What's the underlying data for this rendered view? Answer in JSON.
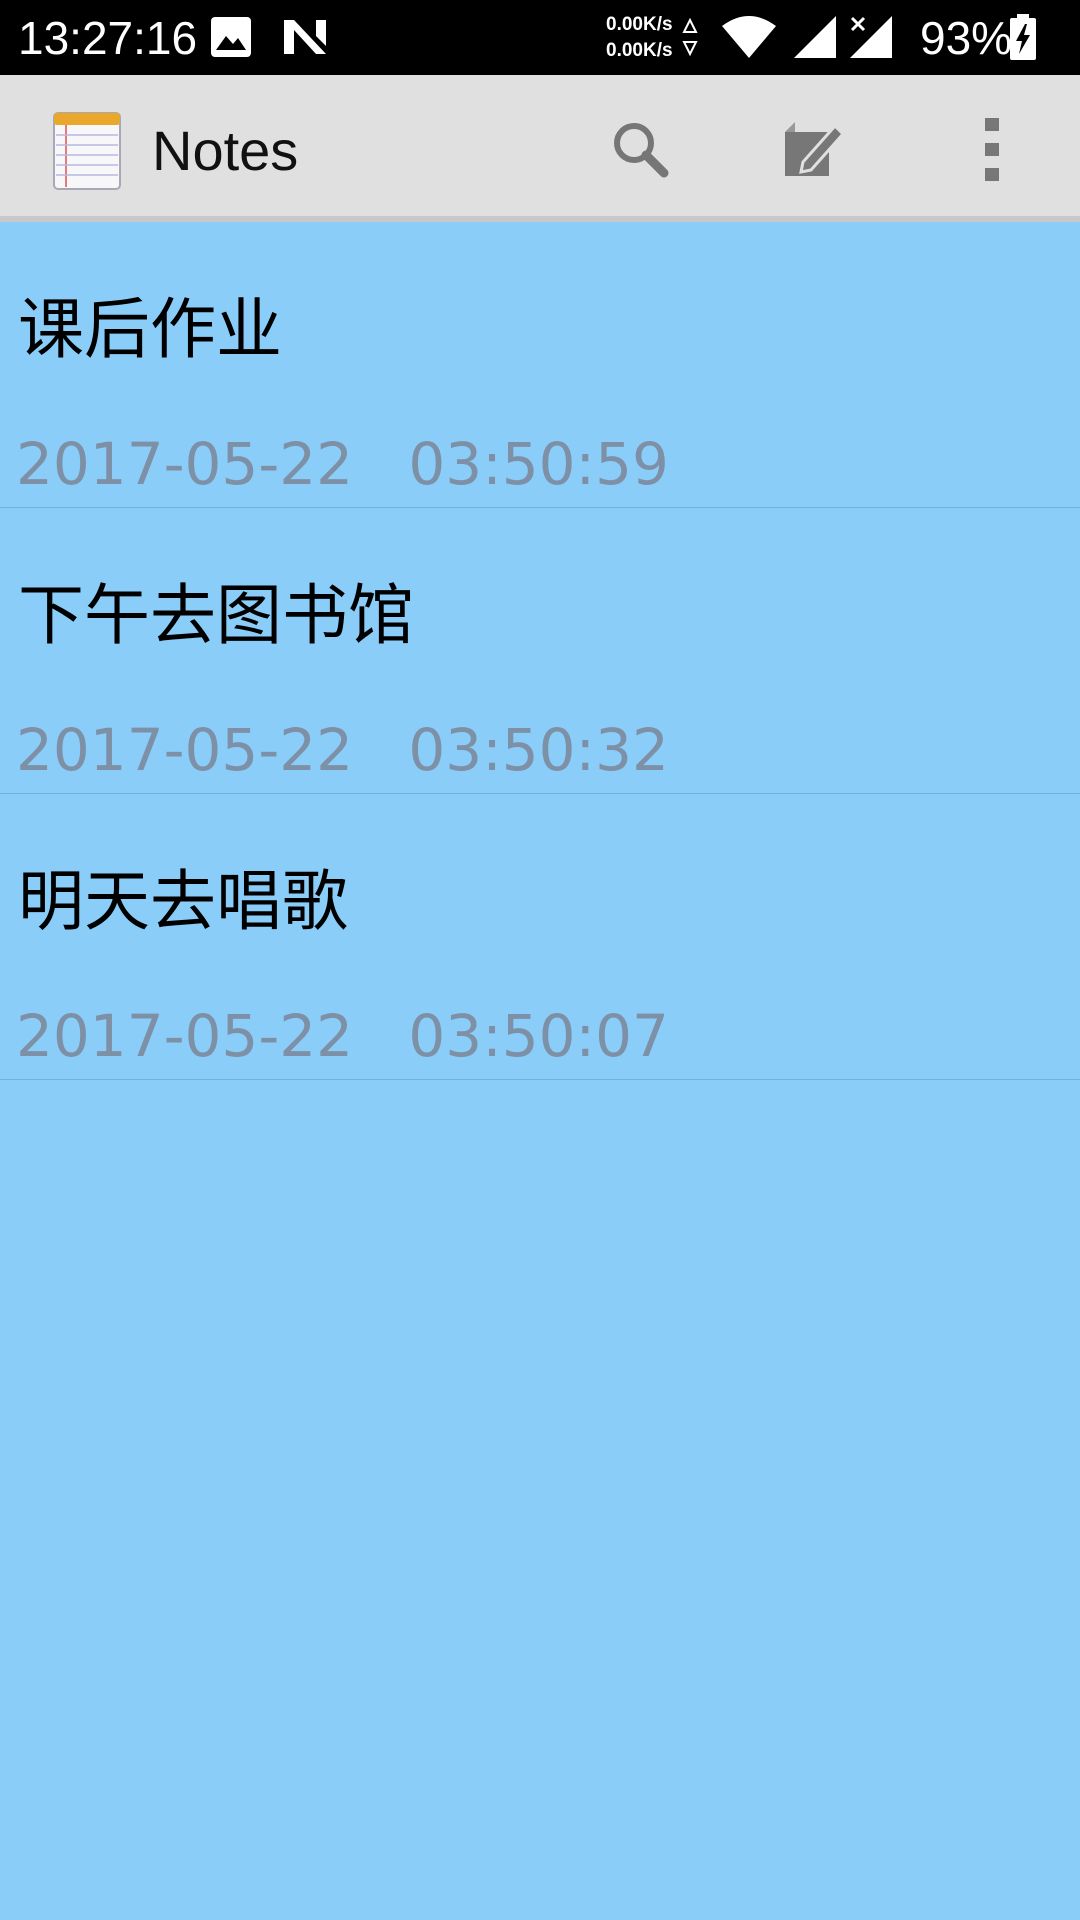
{
  "status_bar": {
    "time": "13:27:16",
    "upload_speed": "0.00K/s",
    "download_speed": "0.00K/s",
    "battery": "93%",
    "icons": [
      "image-icon",
      "n-logo-icon",
      "wifi-icon",
      "signal-icon",
      "signal-no-service-icon",
      "battery-charging-icon"
    ]
  },
  "action_bar": {
    "title": "Notes",
    "app_icon": "notepad-icon",
    "actions": [
      "search-icon",
      "compose-icon",
      "overflow-menu-icon"
    ]
  },
  "notes": [
    {
      "title": "课后作业",
      "date": "2017-05-22",
      "time": "03:50:59"
    },
    {
      "title": "下午去图书馆",
      "date": "2017-05-22",
      "time": "03:50:32"
    },
    {
      "title": "明天去唱歌",
      "date": "2017-05-22",
      "time": "03:50:07"
    }
  ],
  "colors": {
    "background": "#8ACDF9",
    "action_bar": "#E0E0E0",
    "timestamp": "#7E90A6"
  }
}
